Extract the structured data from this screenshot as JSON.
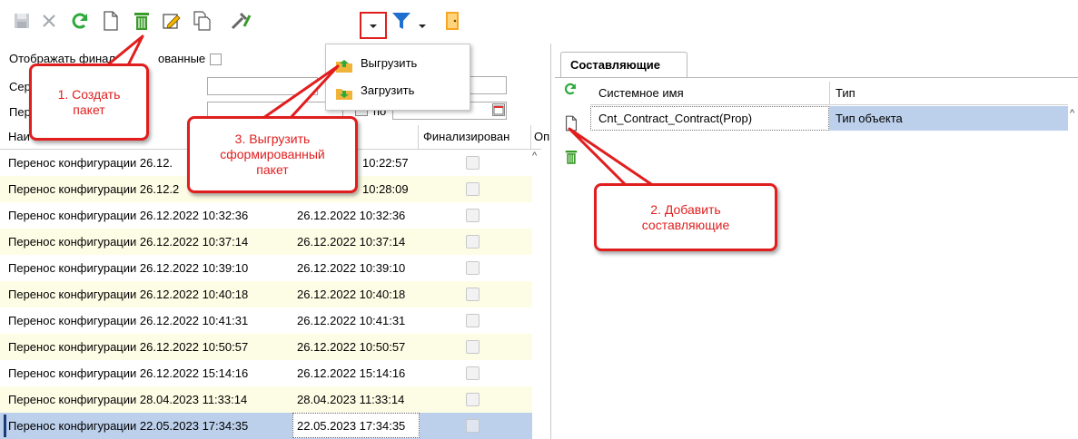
{
  "toolbar": {
    "buttons": [
      "save-icon",
      "cancel-icon",
      "refresh-icon",
      "new-document-icon",
      "delete-icon",
      "edit-icon",
      "copy-icon",
      "tools-icon",
      "dropdown-arrow-icon",
      "filter-icon",
      "dropdown-arrow-icon",
      "exit-door-icon"
    ]
  },
  "export_menu": {
    "items": [
      {
        "label": "Выгрузить",
        "icon": "export-folder-icon"
      },
      {
        "label": "Загрузить",
        "icon": "import-folder-icon"
      }
    ]
  },
  "filters": {
    "show_finalized_label_a": "Отображать финали",
    "show_finalized_label_b": "ованные",
    "row2_label": "Сер",
    "row3_label": "Пер",
    "date_to_label": "по"
  },
  "packages_grid": {
    "columns": [
      "Наименование",
      "",
      "Финализирован",
      "Оп"
    ],
    "header_visible_name": "Наи",
    "header_visible_name_tail": "ание",
    "rows": [
      {
        "name": "Перенос конфигурации 26.12.",
        "date": "10:22:57",
        "partial": true
      },
      {
        "name": "Перенос конфигурации 26.12.2",
        "date": "10:28:09",
        "partial": true
      },
      {
        "name": "Перенос конфигурации 26.12.2022 10:32:36",
        "date": "26.12.2022 10:32:36"
      },
      {
        "name": "Перенос конфигурации 26.12.2022 10:37:14",
        "date": "26.12.2022 10:37:14"
      },
      {
        "name": "Перенос конфигурации 26.12.2022 10:39:10",
        "date": "26.12.2022 10:39:10"
      },
      {
        "name": "Перенос конфигурации 26.12.2022 10:40:18",
        "date": "26.12.2022 10:40:18"
      },
      {
        "name": "Перенос конфигурации 26.12.2022 10:41:31",
        "date": "26.12.2022 10:41:31"
      },
      {
        "name": "Перенос конфигурации 26.12.2022 10:50:57",
        "date": "26.12.2022 10:50:57"
      },
      {
        "name": "Перенос конфигурации 26.12.2022 15:14:16",
        "date": "26.12.2022 15:14:16"
      },
      {
        "name": "Перенос конфигурации 28.04.2023 11:33:14",
        "date": "28.04.2023 11:33:14"
      },
      {
        "name": "Перенос конфигурации 22.05.2023 17:34:35",
        "date": "22.05.2023 17:34:35"
      }
    ]
  },
  "components_panel": {
    "tab_label": "Составляющие",
    "columns": [
      "Системное имя",
      "Тип"
    ],
    "rows": [
      {
        "system_name": "Cnt_Contract_Contract(Prop)",
        "type": "Тип объекта"
      }
    ]
  },
  "callouts": {
    "step1": "1. Создать пакет",
    "step2": "2. Добавить составляющие",
    "step3": "3. Выгрузить сформированный пакет"
  },
  "colors": {
    "accent_red": "#e01e1e",
    "row_alt": "#fdfde6",
    "row_selected": "#bcd0ec",
    "refresh_green": "#2eaa3c"
  }
}
